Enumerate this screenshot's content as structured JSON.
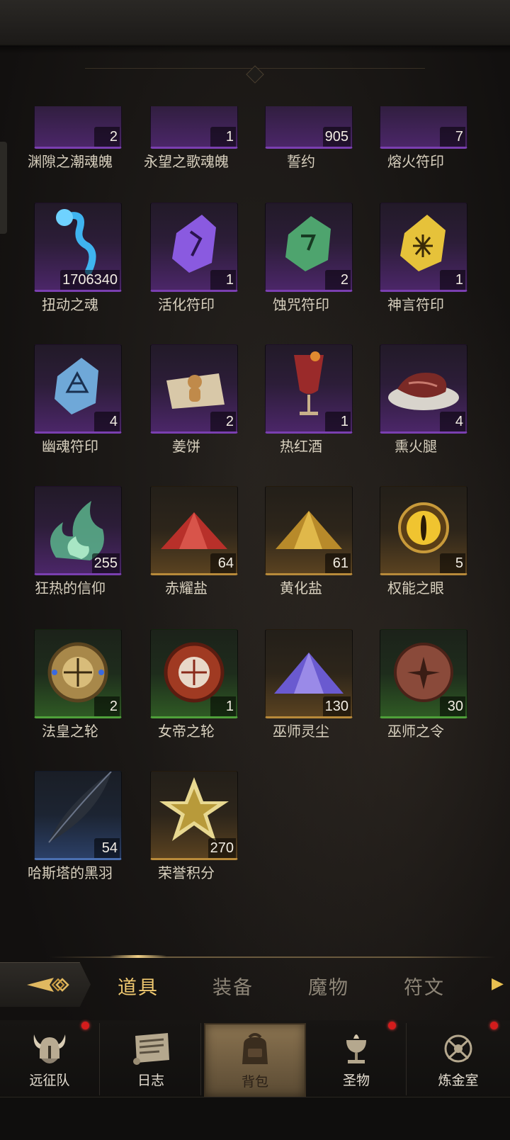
{
  "items": [
    {
      "name": "渊隙之潮魂魄",
      "count": "2",
      "rarity": "purple",
      "icon": "blue-soul-figure-icon"
    },
    {
      "name": "永望之歌魂魄",
      "count": "1",
      "rarity": "purple",
      "icon": "blue-soul-figure-icon"
    },
    {
      "name": "誓约",
      "count": "905",
      "rarity": "purple",
      "icon": "oath-emblem-icon"
    },
    {
      "name": "熔火符印",
      "count": "7",
      "rarity": "purple",
      "icon": "red-rune-stone-icon"
    },
    {
      "name": "扭动之魂",
      "count": "1706340",
      "rarity": "purple",
      "icon": "blue-wisp-icon"
    },
    {
      "name": "活化符印",
      "count": "1",
      "rarity": "purple",
      "icon": "purple-rune-stone-icon"
    },
    {
      "name": "蚀咒符印",
      "count": "2",
      "rarity": "purple",
      "icon": "green-rune-stone-icon"
    },
    {
      "name": "神言符印",
      "count": "1",
      "rarity": "purple",
      "icon": "yellow-rune-stone-icon"
    },
    {
      "name": "幽魂符印",
      "count": "4",
      "rarity": "purple",
      "icon": "ice-rune-stone-icon"
    },
    {
      "name": "姜饼",
      "count": "2",
      "rarity": "purple",
      "icon": "gingerbread-icon"
    },
    {
      "name": "热红酒",
      "count": "1",
      "rarity": "purple",
      "icon": "mulled-wine-icon"
    },
    {
      "name": "熏火腿",
      "count": "4",
      "rarity": "purple",
      "icon": "smoked-ham-icon"
    },
    {
      "name": "狂热的信仰",
      "count": "255",
      "rarity": "purple",
      "icon": "green-flame-icon"
    },
    {
      "name": "赤耀盐",
      "count": "64",
      "rarity": "gold",
      "icon": "red-salt-pile-icon"
    },
    {
      "name": "黄化盐",
      "count": "61",
      "rarity": "gold",
      "icon": "yellow-salt-pile-icon"
    },
    {
      "name": "权能之眼",
      "count": "5",
      "rarity": "gold",
      "icon": "golden-eye-icon"
    },
    {
      "name": "法皇之轮",
      "count": "2",
      "rarity": "green",
      "icon": "golden-wheel-icon"
    },
    {
      "name": "女帝之轮",
      "count": "1",
      "rarity": "green",
      "icon": "red-wheel-icon"
    },
    {
      "name": "巫师灵尘",
      "count": "130",
      "rarity": "gold",
      "icon": "violet-dust-pile-icon"
    },
    {
      "name": "巫师之令",
      "count": "30",
      "rarity": "green",
      "icon": "bronze-seal-icon"
    },
    {
      "name": "哈斯塔的黑羽",
      "count": "54",
      "rarity": "blue",
      "icon": "black-feather-icon"
    },
    {
      "name": "荣誉积分",
      "count": "270",
      "rarity": "gold",
      "icon": "gold-star-icon"
    }
  ],
  "tabs": {
    "items": [
      "道具",
      "装备",
      "魔物",
      "符文"
    ],
    "active": "道具"
  },
  "nav": {
    "items": [
      {
        "label": "远征队",
        "icon": "viking-helmet-icon",
        "badge": true
      },
      {
        "label": "日志",
        "icon": "scroll-icon",
        "badge": false
      },
      {
        "label": "背包",
        "icon": "backpack-icon",
        "badge": false
      },
      {
        "label": "圣物",
        "icon": "chalice-icon",
        "badge": true
      },
      {
        "label": "炼金室",
        "icon": "alchemy-icon",
        "badge": true
      }
    ],
    "active": "背包"
  },
  "colors": {
    "purple": "#7a3fb0",
    "gold": "#b88a3a",
    "green": "#4fa03a",
    "blue": "#4a6fb0",
    "active_tab": "#f0c970",
    "badge": "#d41c1c"
  }
}
